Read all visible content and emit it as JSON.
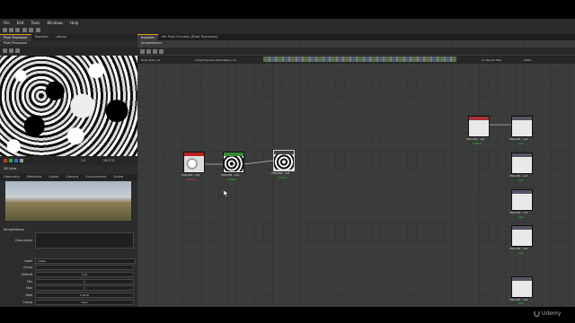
{
  "menu": [
    "File",
    "Edit",
    "Tools",
    "Windows",
    "Help"
  ],
  "left_tabs": {
    "pixel_processor": "Pixel Processor",
    "explorer": "Explorer",
    "library": "Library"
  },
  "viewer_title": "Pixel Processor",
  "viewer_status": {
    "size": "2.0",
    "zoom": "28.27%"
  },
  "view3d": {
    "title": "3D View",
    "tabs": [
      "Geometry",
      "Materials",
      "Lights",
      "Camera",
      "Environment",
      "Scene"
    ]
  },
  "props": {
    "title": "SimpleVector",
    "fields": [
      {
        "label": "Description",
        "value": ""
      },
      {
        "label": "Label",
        "value": "rotate"
      },
      {
        "label": "Group",
        "value": ""
      },
      {
        "label": "Default",
        "value": "1.00"
      },
      {
        "label": "Min",
        "value": "0"
      },
      {
        "label": "Max",
        "value": "1"
      },
      {
        "label": "Step",
        "value": "0.0010"
      },
      {
        "label": "Clamp",
        "value": "False"
      }
    ]
  },
  "graph_tabs": {
    "explorer": "Explorer",
    "pixel_function": "Per Pixel Function [Pixel Processor]"
  },
  "graph_subtitle": "SimpleVector",
  "graph_toolbar": {
    "node_type": "Node Type: All",
    "exposed": "Using Exposed Parameters: All",
    "recent": "11 Recent files",
    "zoom": "100%"
  },
  "nodes": [
    {
      "size": "256x256 - L16",
      "time": "0.12ms",
      "time_color": "#ff4d4d"
    },
    {
      "size": "256x256 - L16",
      "time": "0.36ms",
      "time_color": "#39c739"
    },
    {
      "size": "256x256 - L16",
      "time": "0.23ms",
      "time_color": "#39c739"
    },
    {
      "size": "256x256 - L16",
      "time": "0.08ms",
      "time_color": "#39c739"
    },
    {
      "size": "256x256 - L16",
      "time": "0ms",
      "time_color": "#39c739"
    },
    {
      "size": "256x256 - L16",
      "time": "0ms",
      "time_color": "#39c739"
    },
    {
      "size": "256x256 - L16",
      "time": "0ms",
      "time_color": "#39c739"
    },
    {
      "size": "256x256 - L16",
      "time": "0ms",
      "time_color": "#39c739"
    },
    {
      "size": "256x256 - L16",
      "time": "0ms",
      "time_color": "#39c739"
    }
  ],
  "watermark": "Udemy",
  "colors": {
    "accent": "#d4a017",
    "graph_bg": "#3a3d3b"
  }
}
